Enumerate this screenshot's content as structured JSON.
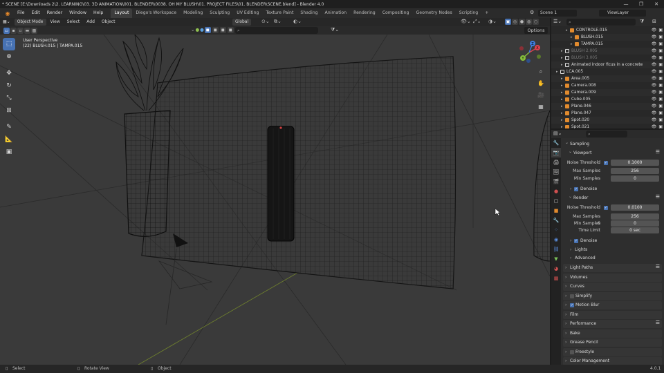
{
  "window": {
    "title": "* SCENE [E:\\Downloads 2\\2. LEARNING\\03. 3D ANIMATION\\001. BLENDER\\0038. OH MY BLUSH\\01. PROJECT FILES\\01. BLENDER\\SCENE.blend] - Blender 4.0",
    "minimize": "—",
    "maximize": "❐",
    "close": "✕"
  },
  "menu": {
    "items": [
      "File",
      "Edit",
      "Render",
      "Window",
      "Help"
    ],
    "workspaces": [
      "Layout",
      "Diego's Workspace",
      "Modeling",
      "Sculpting",
      "UV Editing",
      "Texture Paint",
      "Shading",
      "Animation",
      "Rendering",
      "Compositing",
      "Geometry Nodes",
      "Scripting"
    ],
    "add_workspace": "+",
    "scene_label": "Scene 1",
    "viewlayer_label": "ViewLayer"
  },
  "viewport_header": {
    "mode": "Object Mode",
    "menus": [
      "View",
      "Select",
      "Add",
      "Object"
    ],
    "orientation": "Global",
    "options": "Options"
  },
  "viewport": {
    "perspective": "User Perspective",
    "selection": "(22) BLUSH.015 | TAMPA.015"
  },
  "gizmo": {
    "axis_x": "X",
    "axis_y": "Y",
    "axis_z": "Z",
    "colors": {
      "x": "#e0424e",
      "y": "#86bf3c",
      "z": "#3f7fe0"
    }
  },
  "outliner": {
    "rows": [
      {
        "name": "CONTROLE.015",
        "indent": 3,
        "dim": false,
        "icon": "bone"
      },
      {
        "name": "BLUSH.015",
        "indent": 4,
        "dim": false,
        "icon": "mesh"
      },
      {
        "name": "TAMPA.015",
        "indent": 4,
        "dim": false,
        "icon": "mesh"
      },
      {
        "name": "BLUSH 2.005",
        "indent": 2,
        "dim": true,
        "icon": "collection"
      },
      {
        "name": "BLUSH 3.005",
        "indent": 2,
        "dim": true,
        "icon": "collection"
      },
      {
        "name": "Animated indoor ficus in a concrete",
        "indent": 2,
        "dim": false,
        "icon": "collection"
      },
      {
        "name": "LCA.005",
        "indent": 1,
        "dim": false,
        "icon": "collection"
      },
      {
        "name": "Area.005",
        "indent": 2,
        "dim": false,
        "icon": "light"
      },
      {
        "name": "Camera.008",
        "indent": 2,
        "dim": false,
        "icon": "camera"
      },
      {
        "name": "Camera.009",
        "indent": 2,
        "dim": false,
        "icon": "camera"
      },
      {
        "name": "Cube.005",
        "indent": 2,
        "dim": false,
        "icon": "mesh"
      },
      {
        "name": "Plane.046",
        "indent": 2,
        "dim": false,
        "icon": "mesh"
      },
      {
        "name": "Plane.047",
        "indent": 2,
        "dim": false,
        "icon": "mesh"
      },
      {
        "name": "Spot.020",
        "indent": 2,
        "dim": false,
        "icon": "light"
      },
      {
        "name": "Spot.021",
        "indent": 2,
        "dim": false,
        "icon": "light"
      }
    ]
  },
  "properties": {
    "sampling": "Sampling",
    "viewport": "Viewport",
    "noise_threshold_label": "Noise Threshold",
    "viewport_noise_threshold": "0.1000",
    "max_samples_label": "Max Samples",
    "viewport_max_samples": "256",
    "min_samples_label": "Min Samples",
    "viewport_min_samples": "0",
    "denoise": "Denoise",
    "render": "Render",
    "render_noise_threshold": "0.0100",
    "render_max_samples": "256",
    "render_min_samples": "0",
    "time_limit_label": "Time Limit",
    "time_limit": "0 sec",
    "lights": "Lights",
    "advanced": "Advanced",
    "sections": [
      "Light Paths",
      "Volumes",
      "Curves",
      "Simplify",
      "Motion Blur",
      "Film",
      "Performance",
      "Bake",
      "Grease Pencil",
      "Freestyle",
      "Color Management"
    ]
  },
  "status": {
    "select": "Select",
    "rotate": "Rotate View",
    "object": "Object",
    "version": "4.0.1"
  }
}
